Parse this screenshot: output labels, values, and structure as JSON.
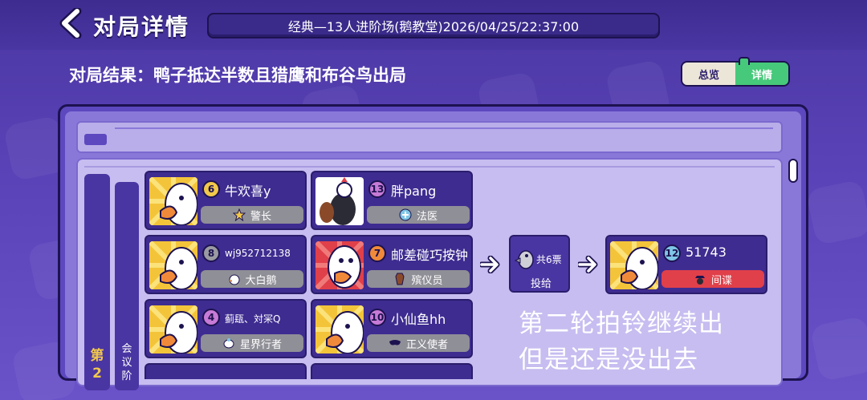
{
  "header": {
    "title": "对局详情",
    "match_info": "经典—13人进阶场(鹅教堂)2026/04/25/22:37:00"
  },
  "result": "对局结果：鸭子抵达半数且猎鹰和布谷鸟出局",
  "view_tabs": {
    "overview": "总览",
    "detail": "详情",
    "active": "detail"
  },
  "round": {
    "label_line1": "第",
    "label_line2": "2",
    "phase_line1": "会",
    "phase_line2": "议",
    "phase_line3": "阶"
  },
  "players": [
    {
      "number": "6",
      "name": "牛欢喜y",
      "role": "警长",
      "badge_color": "#f2c84b",
      "avatar": "goose-yellow"
    },
    {
      "number": "13",
      "name": "胖pang",
      "role": "法医",
      "badge_color": "#c77bd6",
      "avatar": "chicken"
    },
    {
      "number": "8",
      "name": "wj952712138",
      "role": "大白鹅",
      "badge_color": "#9a9aa2",
      "avatar": "goose-yellow"
    },
    {
      "number": "7",
      "name": "邮差碰巧按钟",
      "role": "殡仪员",
      "badge_color": "#f08a3a",
      "avatar": "goose-red"
    },
    {
      "number": "4",
      "name": "蓟瓺、対冞Q",
      "role": "星界行者",
      "badge_color": "#c77bd6",
      "avatar": "goose-yellow"
    },
    {
      "number": "10",
      "name": "小仙鱼hh",
      "role": "正义使者",
      "badge_color": "#c77bd6",
      "avatar": "goose-yellow"
    }
  ],
  "vote": {
    "count": "共6票",
    "label": "投给"
  },
  "target": {
    "number": "12",
    "name": "51743",
    "role": "间谍",
    "badge_color": "#7fc6e6"
  },
  "overlay_caption": {
    "line1": "第二轮拍铃继续出",
    "line2": "但是还是没出去"
  },
  "colors": {
    "background": "#5a43b8",
    "accent_green": "#46c97a",
    "spy_red": "#e0404a"
  }
}
